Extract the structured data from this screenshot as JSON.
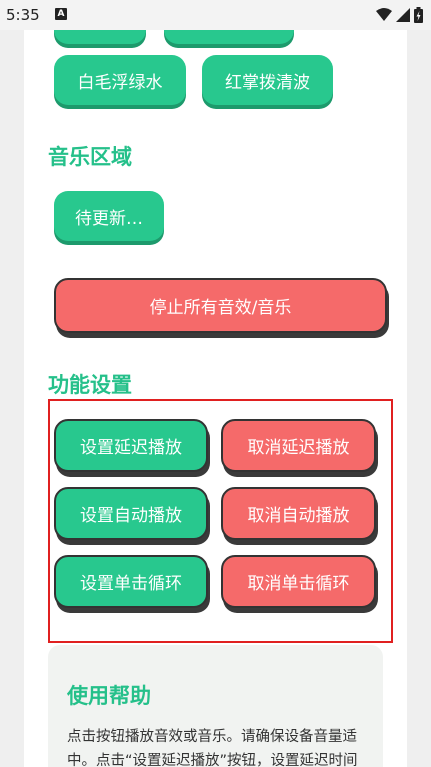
{
  "status_bar": {
    "time": "5:35",
    "notification_badge": "A"
  },
  "sound_buttons": {
    "row1_left": "",
    "row1_right": "",
    "row2_left": "白毛浮绿水",
    "row2_right": "红掌拨清波"
  },
  "music": {
    "title": "音乐区域",
    "pending_label": "待更新…"
  },
  "stop_all_label": "停止所有音效/音乐",
  "settings": {
    "title": "功能设置",
    "set_delay": "设置延迟播放",
    "cancel_delay": "取消延迟播放",
    "set_auto": "设置自动播放",
    "cancel_auto": "取消自动播放",
    "set_loop": "设置单击循环",
    "cancel_loop": "取消单击循环"
  },
  "help": {
    "title": "使用帮助",
    "body": "点击按钮播放音效或音乐。请确保设备音量适中。点击“设置延迟播放”按钮，设置延迟时间（毫秒），点击“设"
  },
  "colors": {
    "accent": "#28c88e",
    "danger": "#f56a6a",
    "highlight_border": "#e02020"
  }
}
